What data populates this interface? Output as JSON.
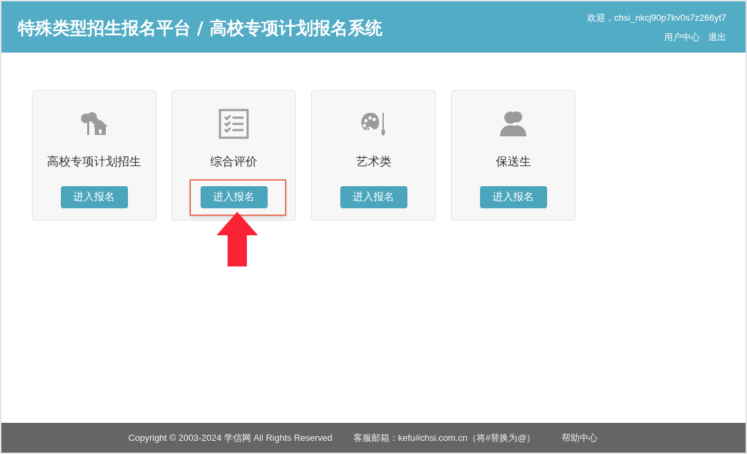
{
  "header": {
    "title": "特殊类型招生报名平台 / 高校专项计划报名系统",
    "welcome": "欢迎，chsi_nkcj90p7kv0s7z266yt7",
    "links": [
      "用户中心",
      "退出"
    ]
  },
  "cards": [
    {
      "kind": "tree-house",
      "title": "高校专项计划招生",
      "button": "进入报名",
      "highlighted": false
    },
    {
      "kind": "checklist",
      "title": "综合评价",
      "button": "进入报名",
      "highlighted": true
    },
    {
      "kind": "palette",
      "title": "艺术类",
      "button": "进入报名",
      "highlighted": false
    },
    {
      "kind": "people",
      "title": "保送生",
      "button": "进入报名",
      "highlighted": false
    }
  ],
  "footer": {
    "copyright": "Copyright © 2003-2024 学信网 All Rights Reserved",
    "email": "客服邮箱：kefu#chsi.com.cn（将#替换为@）",
    "help": "帮助中心"
  }
}
